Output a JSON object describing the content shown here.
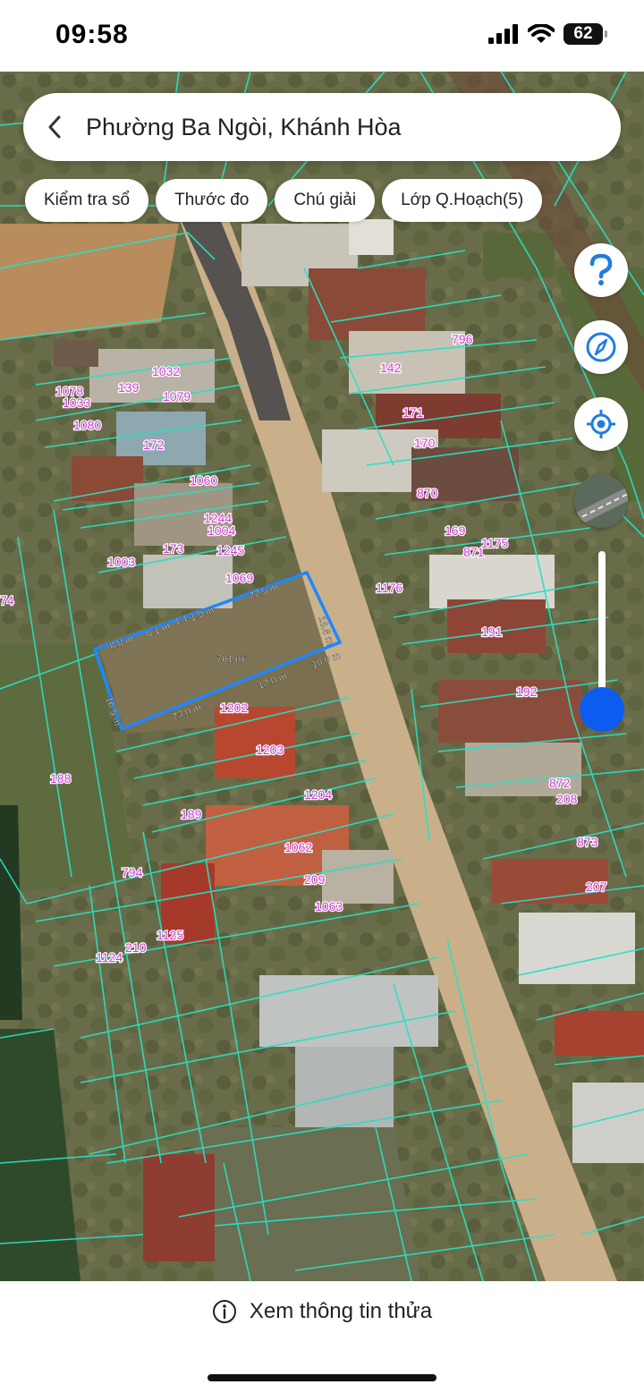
{
  "status_bar": {
    "time": "09:58",
    "battery": "62"
  },
  "search": {
    "place_name": "Phường Ba Ngòi, Khánh Hòa"
  },
  "chips": [
    "Kiểm tra sổ",
    "Thước đo",
    "Chú giải",
    "Lớp Q.Hoạch(5)"
  ],
  "map": {
    "parcel_labels": [
      "796",
      "142",
      "171",
      "170",
      "870",
      "169",
      "871",
      "1175",
      "1176",
      "191",
      "192",
      "872",
      "208",
      "873",
      "207",
      "1032",
      "139",
      "1078",
      "1033",
      "1079",
      "1080",
      "172",
      "1060",
      "1244",
      "1004",
      "173",
      "1245",
      "1003",
      "1069",
      "1203",
      "188",
      "1204",
      "189",
      "1062",
      "794",
      "209",
      "1063",
      "1125",
      "210",
      "1124",
      "1202",
      "74"
    ],
    "selected_parcel": {
      "area": "761 m²",
      "dimensions": [
        "8.8 m",
        "6.1 m",
        "4.4",
        "1.9 m",
        "22.5 m",
        "16.8 m",
        "10.6 m",
        "12.0 m",
        "23.0 m",
        "16.5 m"
      ]
    },
    "zoom_level": 0.15,
    "colors": {
      "boundary": "#27e0c4",
      "selected": "#1e88ff",
      "label": "#c020d8"
    }
  },
  "bottom": {
    "info_text": "Xem thông tin thửa"
  }
}
